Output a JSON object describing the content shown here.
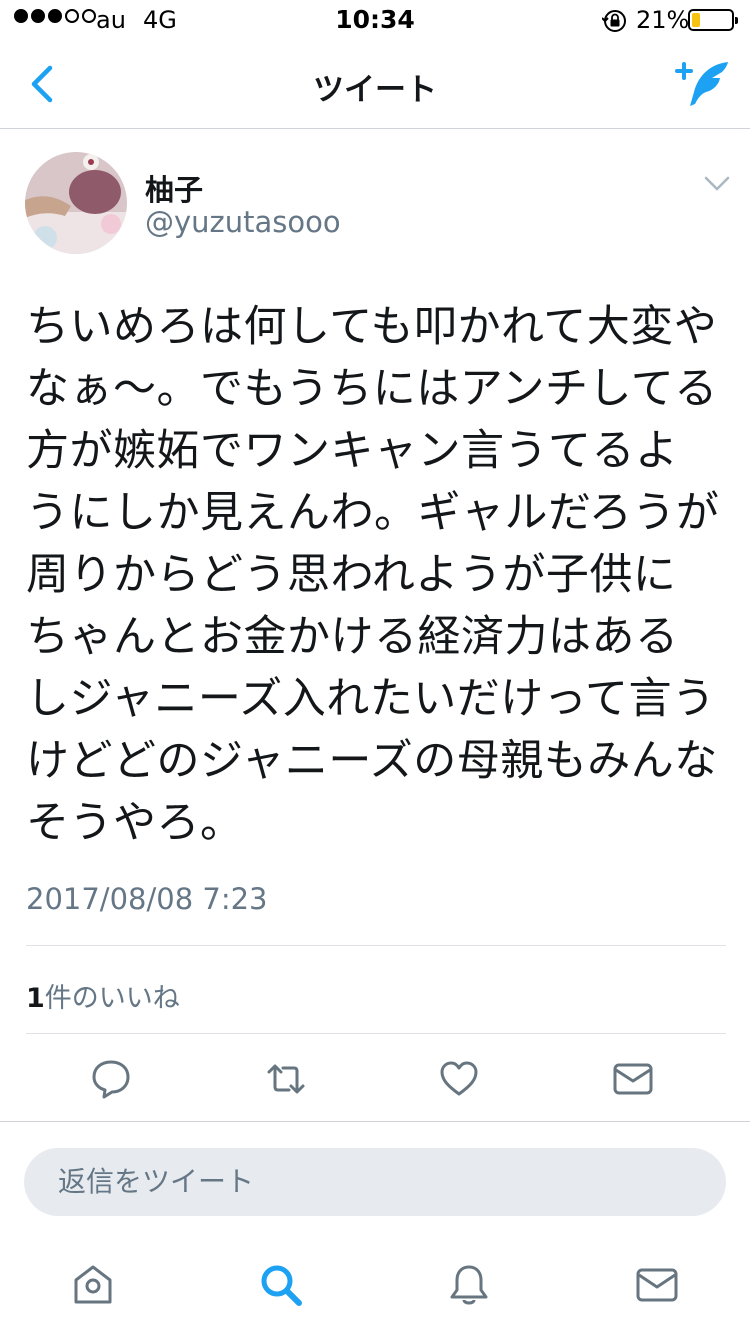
{
  "status_bar": {
    "carrier": "au",
    "network": "4G",
    "time": "10:34",
    "battery_percent": "21%",
    "battery_level": 0.21,
    "signal_bars": 3,
    "signal_total": 5
  },
  "nav": {
    "title": "ツイート",
    "back_icon": "chevron-left-icon",
    "compose_icon": "compose-feather-icon"
  },
  "tweet": {
    "display_name": "柚子",
    "handle": "@yuzutasooo",
    "lines": [
      "ちいめろは何しても叩かれて大変や",
      "なぁ〜。でもうちにはアンチしてる",
      "方が嫉妬でワンキャン言うてるよ",
      "うにしか見えんわ。ギャルだろうが",
      "周りからどう思われようが子供に",
      "ちゃんとお金かける経済力はある",
      "しジャニーズ入れたいだけって言う",
      "けどどのジャニーズの母親もみんな",
      "そうやろ。"
    ],
    "timestamp": "2017/08/08 7:23",
    "likes_count": "1",
    "likes_label": "件のいいね"
  },
  "actions": [
    "reply-icon",
    "retweet-icon",
    "like-icon",
    "direct-message-icon"
  ],
  "reply": {
    "placeholder": "返信をツイート"
  },
  "tab_bar": [
    "home-icon",
    "search-icon",
    "notifications-icon",
    "messages-icon"
  ],
  "colors": {
    "accent": "#1da1f2",
    "secondary_text": "#657786",
    "icon_gray": "#66757f",
    "battery_fill": "#f7c312",
    "reply_bg": "#e7ebef"
  }
}
